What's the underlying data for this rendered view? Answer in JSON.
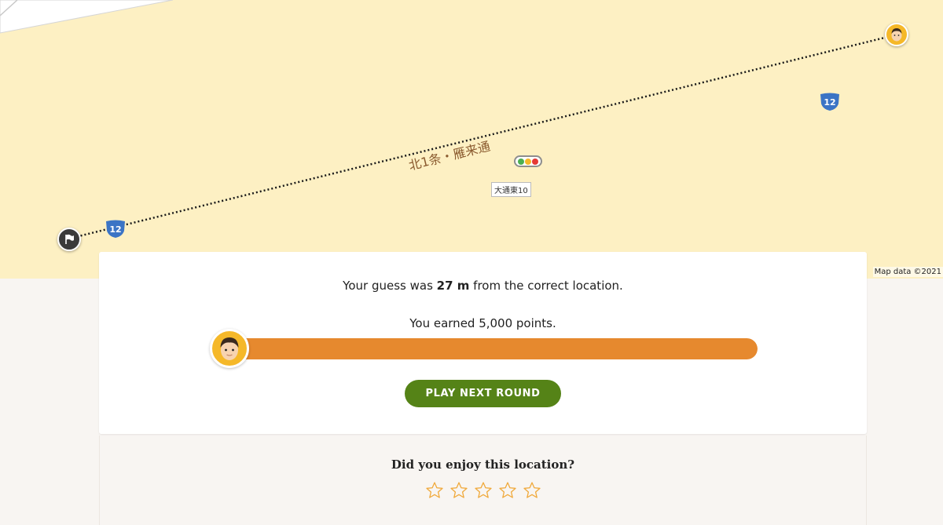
{
  "map": {
    "street_name": "北1条・雁来通",
    "place_label": "大通東10",
    "route_number": "12",
    "attribution": "Map data ©2021",
    "traffic_light_colors": [
      "#4caf50",
      "#f5b829",
      "#e53935"
    ]
  },
  "result": {
    "distance_prefix": "Your guess was ",
    "distance_value": "27 m",
    "distance_suffix": " from the correct location.",
    "points_text": "You earned 5,000 points.",
    "progress_fraction": 1.0,
    "next_button_label": "PLAY NEXT ROUND"
  },
  "rating": {
    "question": "Did you enjoy this location?",
    "star_count": 5,
    "selected": 0
  },
  "colors": {
    "map_background": "#fdf0c3",
    "progress_fill": "#e6892e",
    "next_button": "#558317",
    "avatar_background": "#f5b829",
    "star_outline": "#f0a93b"
  },
  "icons": {
    "guess_marker": "avatar-icon",
    "correct_marker": "flag-icon",
    "route_shield": "route-shield-icon",
    "rating_star": "star-outline-icon"
  }
}
